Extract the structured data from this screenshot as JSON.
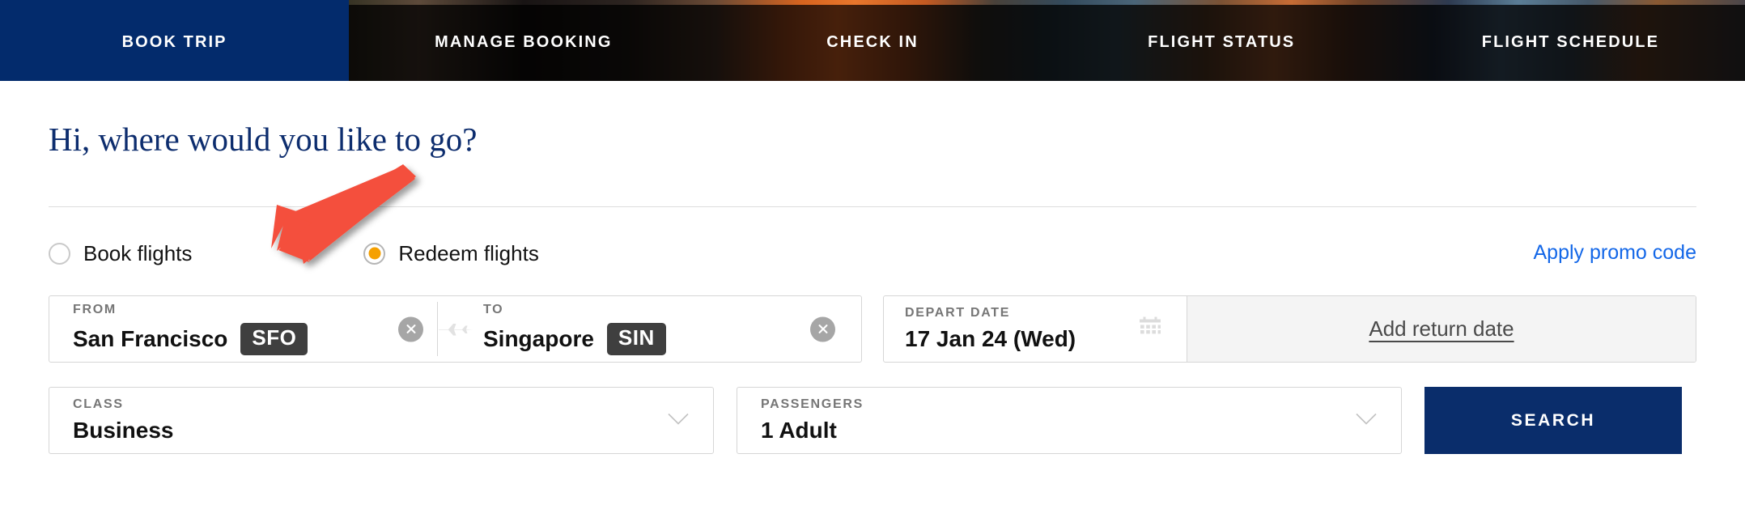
{
  "nav": {
    "items": [
      {
        "label": "BOOK TRIP",
        "active": true
      },
      {
        "label": "MANAGE BOOKING",
        "active": false
      },
      {
        "label": "CHECK IN",
        "active": false
      },
      {
        "label": "FLIGHT STATUS",
        "active": false
      },
      {
        "label": "FLIGHT SCHEDULE",
        "active": false
      }
    ],
    "active_color": "#032b6c"
  },
  "main": {
    "title": "Hi, where would you like to go?",
    "title_color": "#0d2d6e",
    "trip_type": {
      "options": [
        {
          "label": "Book flights",
          "selected": false
        },
        {
          "label": "Redeem flights",
          "selected": true
        }
      ],
      "selected_dot_color": "#f5a000"
    },
    "promo_link": "Apply promo code",
    "promo_link_color": "#1367e8",
    "from": {
      "label": "FROM",
      "city": "San Francisco",
      "code": "SFO",
      "clear_icon": "close-circle-icon"
    },
    "swap_icon": "airplane-icon",
    "to": {
      "label": "TO",
      "city": "Singapore",
      "code": "SIN",
      "clear_icon": "close-circle-icon"
    },
    "depart": {
      "label": "DEPART DATE",
      "value": "17 Jan 24 (Wed)",
      "icon": "calendar-icon"
    },
    "return": {
      "label": "Add return date"
    },
    "travel_class": {
      "label": "CLASS",
      "value": "Business",
      "icon": "chevron-down-icon"
    },
    "passengers": {
      "label": "PASSENGERS",
      "value": "1 Adult",
      "icon": "chevron-down-icon"
    },
    "search_button": {
      "label": "SEARCH",
      "color": "#0a2d6b"
    }
  },
  "annotation": {
    "arrow_color": "#f4503c",
    "points_at": "Redeem flights"
  }
}
